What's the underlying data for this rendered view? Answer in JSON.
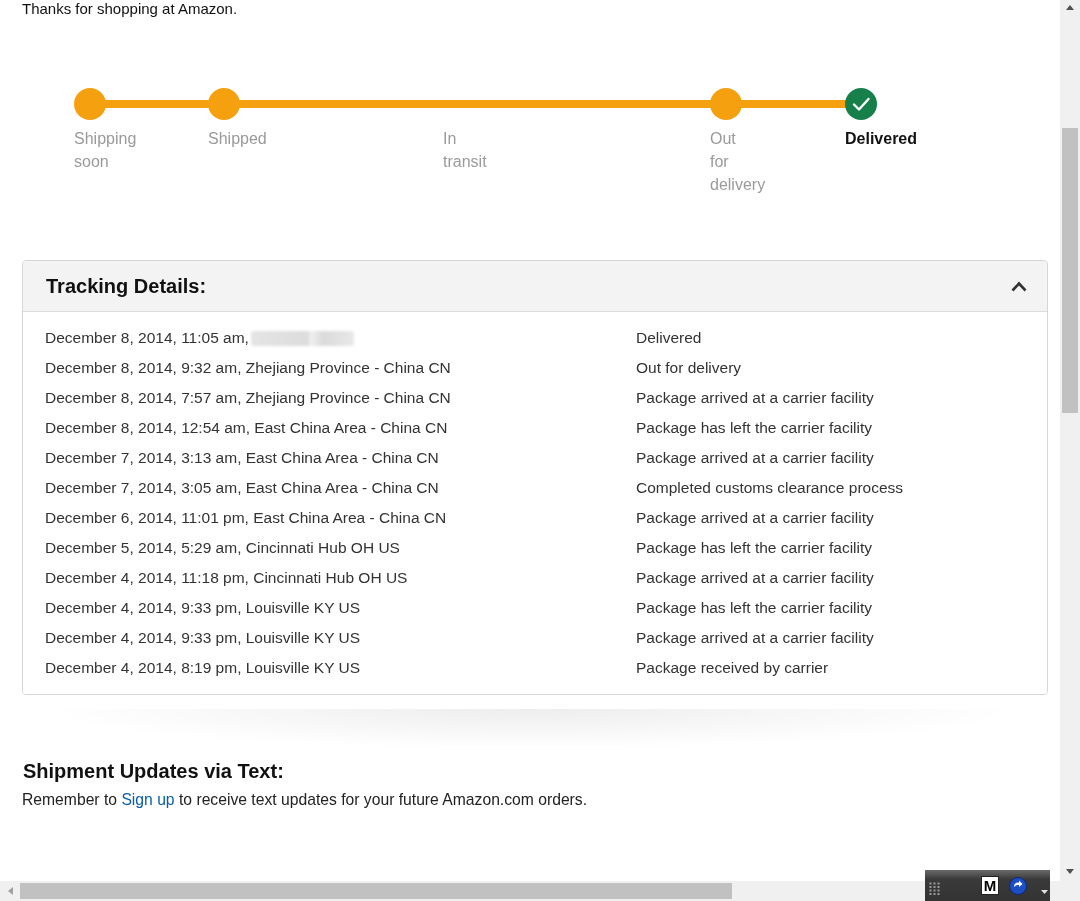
{
  "intro": {
    "text": "Thanks for shopping at Amazon."
  },
  "progress": {
    "steps": [
      {
        "label": "Shipping soon",
        "completed": true,
        "current": false
      },
      {
        "label": "Shipped",
        "completed": true,
        "current": false
      },
      {
        "label": "In transit",
        "completed": false,
        "current": false
      },
      {
        "label": "Out for delivery",
        "completed": true,
        "current": false
      },
      {
        "label": "Delivered",
        "completed": true,
        "current": true
      }
    ]
  },
  "tracking": {
    "title": "Tracking Details:",
    "expanded": true,
    "events": [
      {
        "when_where": "December 8, 2014, 11:05 am,",
        "redacted": true,
        "status": "Delivered"
      },
      {
        "when_where": "December 8, 2014, 9:32 am, Zhejiang Province - China CN",
        "redacted": false,
        "status": "Out for delivery"
      },
      {
        "when_where": "December 8, 2014, 7:57 am, Zhejiang Province - China CN",
        "redacted": false,
        "status": "Package arrived at a carrier facility"
      },
      {
        "when_where": "December 8, 2014, 12:54 am, East China Area - China CN",
        "redacted": false,
        "status": "Package has left the carrier facility"
      },
      {
        "when_where": "December 7, 2014, 3:13 am, East China Area - China CN",
        "redacted": false,
        "status": "Package arrived at a carrier facility"
      },
      {
        "when_where": "December 7, 2014, 3:05 am, East China Area - China CN",
        "redacted": false,
        "status": "Completed customs clearance process"
      },
      {
        "when_where": "December 6, 2014, 11:01 pm, East China Area - China CN",
        "redacted": false,
        "status": "Package arrived at a carrier facility"
      },
      {
        "when_where": "December 5, 2014, 5:29 am, Cincinnati Hub OH US",
        "redacted": false,
        "status": "Package has left the carrier facility"
      },
      {
        "when_where": "December 4, 2014, 11:18 pm, Cincinnati Hub OH US",
        "redacted": false,
        "status": "Package arrived at a carrier facility"
      },
      {
        "when_where": "December 4, 2014, 9:33 pm, Louisville KY US",
        "redacted": false,
        "status": "Package has left the carrier facility"
      },
      {
        "when_where": "December 4, 2014, 9:33 pm, Louisville KY US",
        "redacted": false,
        "status": "Package arrived at a carrier facility"
      },
      {
        "when_where": "December 4, 2014, 8:19 pm, Louisville KY US",
        "redacted": false,
        "status": "Package received by carrier"
      }
    ]
  },
  "text_updates": {
    "title": "Shipment Updates via Text:",
    "before": "Remember to",
    "link": "Sign up",
    "after": "to receive text updates for your future Amazon.com orders."
  },
  "language_bar": {
    "mode": "M"
  }
}
